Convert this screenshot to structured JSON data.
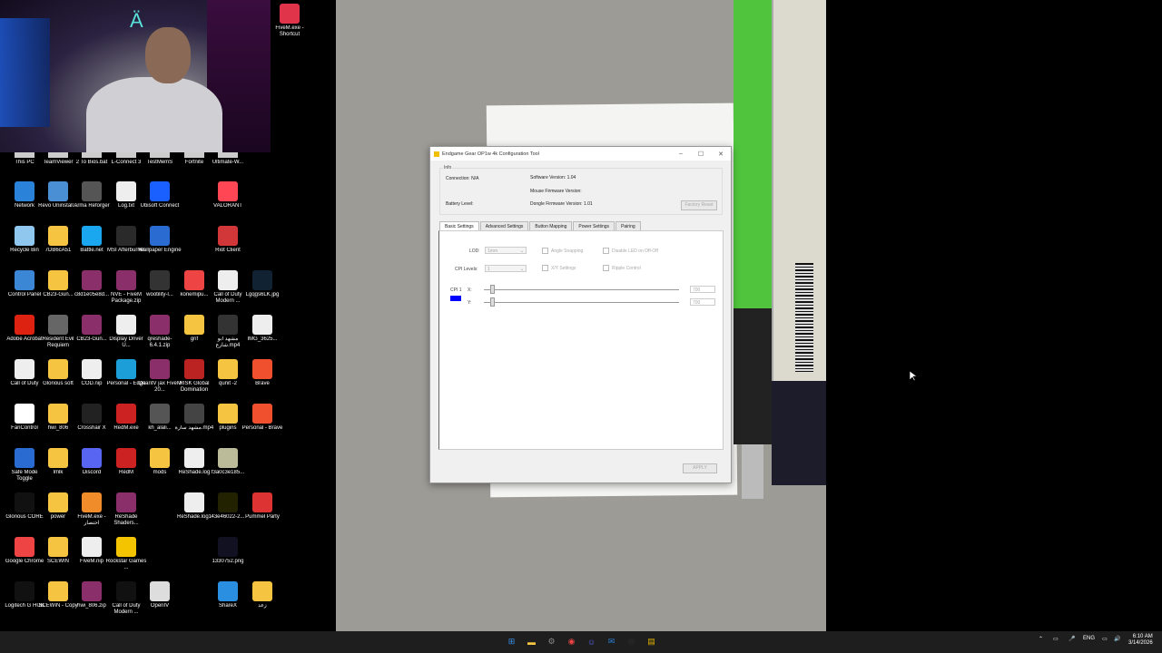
{
  "desktop": {
    "top_partial_labels": [
      "This PC",
      "TeamViewer",
      "2 To Bios.bat",
      "L-Connect 3",
      "TestMemS",
      "Fortnite",
      "Ultimate-W..."
    ],
    "icons": [
      {
        "label": "FiveM.exe - Shortcut",
        "icon": "fivem-icon",
        "color": "#e0344a"
      },
      {
        "label": "Network",
        "icon": "network-icon",
        "color": "#2b82d9"
      },
      {
        "label": "Revo Uninstall...",
        "icon": "revo-icon",
        "color": "#4a8fd3"
      },
      {
        "label": "Arma Reforger",
        "icon": "arma-icon",
        "color": "#555"
      },
      {
        "label": "Log.txt",
        "icon": "text-file-icon",
        "color": "#eee"
      },
      {
        "label": "Ubisoft Connect",
        "icon": "ubisoft-icon",
        "color": "#1a5fff"
      },
      {
        "label": "VALORANT",
        "icon": "valorant-icon",
        "color": "#ff4655"
      },
      {
        "label": "Recycle Bin",
        "icon": "recycle-bin-icon",
        "color": "#8fc7ef"
      },
      {
        "label": "7DB6cA51",
        "icon": "folder-icon",
        "color": "#f5c542"
      },
      {
        "label": "Battle.net",
        "icon": "battlenet-icon",
        "color": "#1aa7f0"
      },
      {
        "label": "MSI Afterburner",
        "icon": "msi-icon",
        "color": "#2a2a2a"
      },
      {
        "label": "Wallpaper Engine",
        "icon": "wallpaper-engine-icon",
        "color": "#2a6bd1"
      },
      {
        "label": "Riot Client",
        "icon": "riot-icon",
        "color": "#d13639"
      },
      {
        "label": "Control Panel",
        "icon": "control-panel-icon",
        "color": "#3b87d6"
      },
      {
        "label": "CB23-Gun...",
        "icon": "folder-icon",
        "color": "#f5c542"
      },
      {
        "label": "c8d1e05e8d...",
        "icon": "winrar-icon",
        "color": "#8a2f6a"
      },
      {
        "label": "NVE - FiveM Package.zip",
        "icon": "winrar-icon",
        "color": "#8a2f6a"
      },
      {
        "label": "wootility-l...",
        "icon": "wooting-icon",
        "color": "#333"
      },
      {
        "label": "konemipu...",
        "icon": "chrome-icon",
        "color": "#e44"
      },
      {
        "label": "Call of Duty Modern ...",
        "icon": "file-icon",
        "color": "#eee"
      },
      {
        "label": "Lgqgs6LK.jpg",
        "icon": "image-file-icon",
        "color": "#123"
      },
      {
        "label": "Adobe Acrobat",
        "icon": "acrobat-icon",
        "color": "#d21"
      },
      {
        "label": "Resident Evil Requiem",
        "icon": "re-icon",
        "color": "#666"
      },
      {
        "label": "CB23-Gun...",
        "icon": "winrar-icon",
        "color": "#8a2f6a"
      },
      {
        "label": "Display Driver U...",
        "icon": "file-icon",
        "color": "#eee"
      },
      {
        "label": "qreshade-6.4.1.zip",
        "icon": "winrar-icon",
        "color": "#8a2f6a"
      },
      {
        "label": "grif",
        "icon": "folder-icon",
        "color": "#f5c542"
      },
      {
        "label": "مشهد ابو شارع.mp4",
        "icon": "video-file-icon",
        "color": "#333"
      },
      {
        "label": "IMG_3625...",
        "icon": "file-icon",
        "color": "#eee"
      },
      {
        "label": "Call of Duty",
        "icon": "file-icon",
        "color": "#eee"
      },
      {
        "label": "Glorious soft",
        "icon": "folder-icon",
        "color": "#f5c542"
      },
      {
        "label": "COD.nip",
        "icon": "file-icon",
        "color": "#eee"
      },
      {
        "label": "Personal - Edge",
        "icon": "edge-icon",
        "color": "#1c9fd8"
      },
      {
        "label": "QuantV jax FiveM 20...",
        "icon": "winrar-icon",
        "color": "#8a2f6a"
      },
      {
        "label": "RISK Global Domination",
        "icon": "risk-icon",
        "color": "#b22"
      },
      {
        "label": "qunit -2",
        "icon": "folder-icon",
        "color": "#f5c542"
      },
      {
        "label": "Brave",
        "icon": "brave-icon",
        "color": "#f1502f"
      },
      {
        "label": "FanControl",
        "icon": "fan-icon",
        "color": "#fff"
      },
      {
        "label": "hwi_806",
        "icon": "folder-icon",
        "color": "#f5c542"
      },
      {
        "label": "Crosshair X",
        "icon": "crosshair-icon",
        "color": "#222"
      },
      {
        "label": "RedM.exe",
        "icon": "redm-icon",
        "color": "#c22"
      },
      {
        "label": "kh_alali...",
        "icon": "video-file-icon",
        "color": "#555"
      },
      {
        "label": "مشهد سارة.mp4",
        "icon": "video-file-icon",
        "color": "#444"
      },
      {
        "label": "plugins",
        "icon": "folder-icon",
        "color": "#f5c542"
      },
      {
        "label": "Personal - Brave",
        "icon": "brave-icon",
        "color": "#f1502f"
      },
      {
        "label": "Safe Mode Toggle",
        "icon": "safemode-icon",
        "color": "#2a6bd1"
      },
      {
        "label": "lmlk",
        "icon": "folder-icon",
        "color": "#f5c542"
      },
      {
        "label": "Discord",
        "icon": "discord-icon",
        "color": "#5865f2"
      },
      {
        "label": "RedM",
        "icon": "redm-icon",
        "color": "#c22"
      },
      {
        "label": "mods",
        "icon": "folder-icon",
        "color": "#f5c542"
      },
      {
        "label": "ReShade.log",
        "icon": "text-file-icon",
        "color": "#eee"
      },
      {
        "label": "f3a0c3e185...",
        "icon": "image-file-icon",
        "color": "#bb9"
      },
      {
        "label": "Glorious CORE",
        "icon": "glorious-icon",
        "color": "#111"
      },
      {
        "label": "power",
        "icon": "folder-icon",
        "color": "#f5c542"
      },
      {
        "label": "FiveM.exe - اختصار",
        "icon": "fivem-icon",
        "color": "#f08c2a"
      },
      {
        "label": "ReShade Shaders...",
        "icon": "winrar-icon",
        "color": "#8a2f6a"
      },
      {
        "label": "ReShade.log1",
        "icon": "text-file-icon",
        "color": "#eee"
      },
      {
        "label": "43e46022-2...",
        "icon": "image-file-icon",
        "color": "#220"
      },
      {
        "label": "Pummel Party",
        "icon": "pummel-icon",
        "color": "#d33"
      },
      {
        "label": "Google Chrome",
        "icon": "chrome-icon",
        "color": "#e44"
      },
      {
        "label": "SCEWIN",
        "icon": "folder-icon",
        "color": "#f5c542"
      },
      {
        "label": "FiveM.nip",
        "icon": "file-icon",
        "color": "#eee"
      },
      {
        "label": "Rockstar Games ...",
        "icon": "rockstar-icon",
        "color": "#f4c400"
      },
      {
        "label": "1330752.png",
        "icon": "image-file-icon",
        "color": "#112"
      },
      {
        "label": "Logitech G HUB",
        "icon": "logitech-icon",
        "color": "#111"
      },
      {
        "label": "SCEWIN - Copy",
        "icon": "folder-icon",
        "color": "#f5c542"
      },
      {
        "label": "hwi_806.zip",
        "icon": "winrar-icon",
        "color": "#8a2f6a"
      },
      {
        "label": "Call of Duty Modern ...",
        "icon": "cod-icon",
        "color": "#111"
      },
      {
        "label": "OpenIV",
        "icon": "openiv-icon",
        "color": "#ddd"
      },
      {
        "label": "ShareX",
        "icon": "sharex-icon",
        "color": "#2a8fe0"
      },
      {
        "label": "زعد",
        "icon": "folder-icon",
        "color": "#f5c542"
      }
    ]
  },
  "dialog": {
    "title": "Endgame Gear OP1w 4k Configuration Tool",
    "info_legend": "Info",
    "connection": "Connection: N/A",
    "battery": "Battery Level:",
    "software_version": "Software Version:  1.04",
    "mouse_firmware": "Mouse Firmware Version:",
    "dongle_firmware": "Dongle Firmware Version:  1.01",
    "factory_reset": "Factory Reset",
    "tabs": [
      "Basic Settings",
      "Advanced Settings",
      "Button Mapping",
      "Power Settings",
      "Pairing"
    ],
    "lod_label": "LOD:",
    "lod_value": "1mm",
    "cpi_levels_label": "CPI Levels:",
    "cpi_levels_value": "1",
    "angle_snapping": "Angle Snapping",
    "xy_settings": "X/Y Settings",
    "disable_led": "Disable LED on Off-Off",
    "ripple_control": "Ripple Control",
    "cpi1_label": "CPI 1",
    "cpi1_color": "#0000ff",
    "x_label": "X:",
    "y_label": "Y:",
    "x_value": "700",
    "y_value": "700",
    "apply": "APPLY"
  },
  "taskbar": {
    "icons": [
      "windows-start-icon",
      "file-explorer-icon",
      "settings-icon",
      "chrome-icon",
      "discord-icon",
      "mail-icon",
      "obs-icon",
      "configurator-icon"
    ],
    "tray_lang": "ENG",
    "time": "6:10 AM",
    "date": "3/14/2026"
  }
}
